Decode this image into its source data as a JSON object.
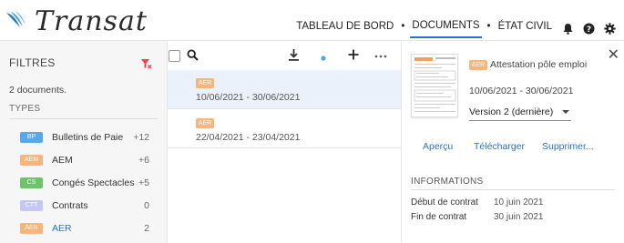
{
  "app": {
    "logo_text": "Transat"
  },
  "nav": {
    "items": [
      {
        "label": "TABLEAU DE BORD",
        "active": false
      },
      {
        "label": "DOCUMENTS",
        "active": true
      },
      {
        "label": "ÉTAT CIVIL",
        "active": false
      }
    ],
    "separator": "•",
    "icons": [
      "bell-icon",
      "help-icon",
      "settings-icon"
    ]
  },
  "sidebar": {
    "title": "FILTRES",
    "count_text": "2 documents.",
    "types_heading": "TYPES",
    "types": [
      {
        "badge": "BP",
        "label": "Bulletins de Paie",
        "count": "+12",
        "color": "#5aa8ea"
      },
      {
        "badge": "AEM",
        "label": "AEM",
        "count": "+6",
        "color": "#f5b57c"
      },
      {
        "badge": "CS",
        "label": "Congés Spectacles",
        "count": "+5",
        "color": "#6cc36b"
      },
      {
        "badge": "CTT",
        "label": "Contrats",
        "count": "0",
        "color": "#c4c7f4"
      },
      {
        "badge": "AER",
        "label": "AER",
        "count": "2",
        "color": "#f5b57c"
      }
    ]
  },
  "list": {
    "toolbar_icons": [
      "checkbox",
      "search-icon",
      "download-icon",
      "dot-icon",
      "add-icon",
      "more-icon"
    ],
    "documents": [
      {
        "badge": "AER",
        "dates": "10/06/2021 - 30/06/2021",
        "selected": true
      },
      {
        "badge": "AER",
        "dates": "22/04/2021 - 23/04/2021",
        "selected": false
      }
    ]
  },
  "detail": {
    "badge": "AER",
    "title": "Attestation pôle emploi",
    "dates": "10/06/2021 - 30/06/2021",
    "version": "Version 2 (dernière)",
    "actions": [
      "Aperçu",
      "Télécharger",
      "Supprimer..."
    ],
    "info_heading": "INFORMATIONS",
    "info": [
      {
        "label": "Début de contrat",
        "value": "10 juin 2021"
      },
      {
        "label": "Fin de contrat",
        "value": "30 juin 2021"
      }
    ]
  },
  "colors": {
    "accent": "#2a6fd6",
    "filter_red": "#e8424d",
    "dot_blue": "#4aa6e8",
    "aer_orange": "#f5b57c"
  }
}
